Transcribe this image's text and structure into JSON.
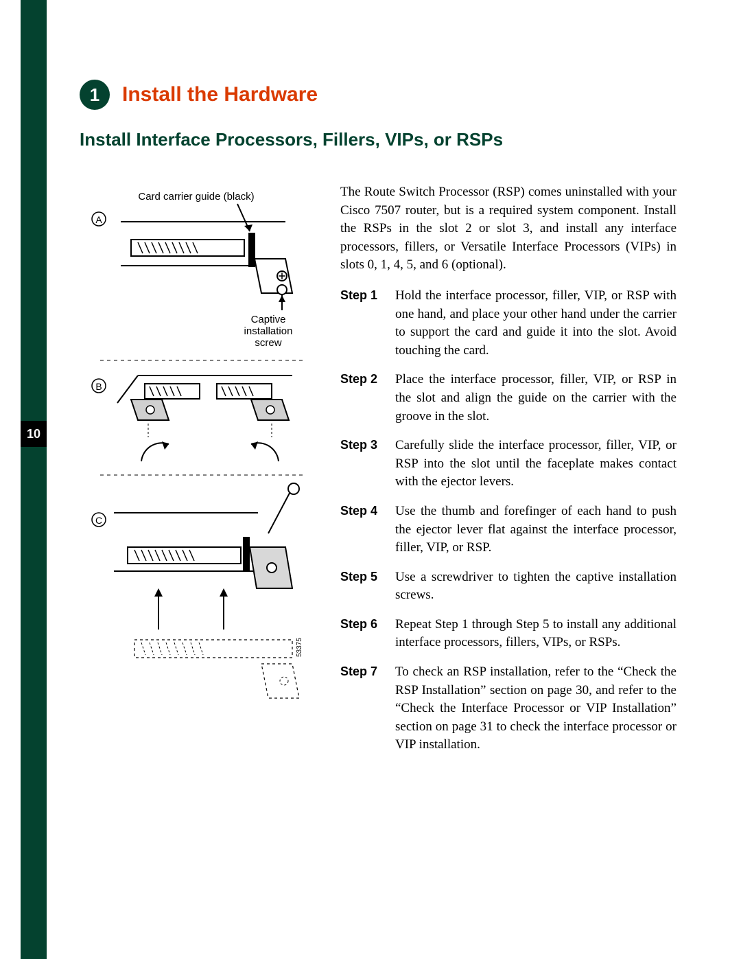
{
  "page_number": "10",
  "chapter_number": "1",
  "chapter_title": "Install the Hardware",
  "section_title": "Install Interface Processors, Fillers, VIPs, or RSPs",
  "intro": "The Route Switch Processor (RSP) comes uninstalled with your Cisco 7507 router, but is a required system component. Install the RSPs in the slot 2 or slot 3, and install any interface processors, fillers, or Versatile Interface Processors (VIPs) in slots 0, 1, 4, 5, and 6 (optional).",
  "diagram": {
    "marker_a": "A",
    "marker_b": "B",
    "marker_c": "C",
    "label_card_guide": "Card carrier guide (black)",
    "label_screw_1": "Captive",
    "label_screw_2": "installation",
    "label_screw_3": "screw",
    "figure_id": "53375"
  },
  "steps": [
    {
      "label": "Step 1",
      "text": "Hold the interface processor, filler, VIP, or RSP with one hand, and place your other hand under the carrier to support the card and guide it into the slot. Avoid touching the card."
    },
    {
      "label": "Step 2",
      "text": "Place the interface processor, filler, VIP, or RSP in the slot and align the guide on the carrier with the groove in the slot."
    },
    {
      "label": "Step 3",
      "text": "Carefully slide the interface processor, filler, VIP, or RSP into the slot until the faceplate makes contact with the ejector levers."
    },
    {
      "label": "Step 4",
      "text": "Use the thumb and forefinger of each hand to push the ejector lever flat against the interface processor, filler, VIP, or RSP."
    },
    {
      "label": "Step 5",
      "text": "Use a screwdriver to tighten the captive installation screws."
    },
    {
      "label": "Step 6",
      "text": "Repeat Step 1 through Step 5 to install any additional interface processors, fillers, VIPs, or RSPs."
    },
    {
      "label": "Step 7",
      "text": "To check an RSP installation, refer to the “Check the RSP Installation” section on page 30, and refer to the “Check the Interface Processor or VIP Installation” section on page 31 to check the interface processor or VIP installation."
    }
  ]
}
